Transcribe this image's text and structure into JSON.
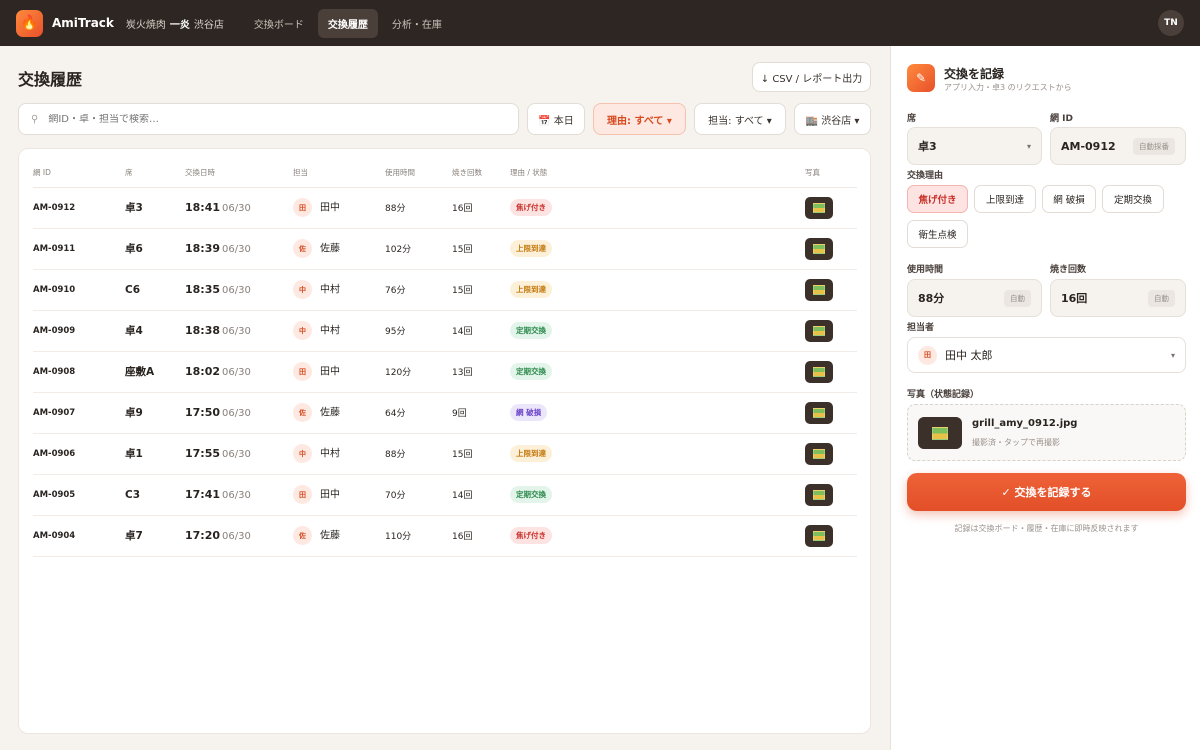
{
  "header": {
    "logo_icon": "fire-icon",
    "brand": "AmiTrack",
    "shop_prefix": "炭火焼肉",
    "shop_name": "一炎",
    "shop_branch": "渋谷店",
    "tabs": [
      "交換ボード",
      "交換履歴",
      "分析・在庫"
    ],
    "active_tab": "交換履歴",
    "user_initials": "TN"
  },
  "page": {
    "title": "交換履歴",
    "export_label": "↓ CSV / レポート出力",
    "search_placeholder": "網ID・卓・担当で検索…",
    "filters": {
      "date": "📅 本日",
      "reason": "理由: すべて ▾",
      "staff": "担当: すべて ▾",
      "store": "🏬 渋谷店 ▾"
    }
  },
  "table": {
    "headers": [
      "網 ID",
      "席",
      "交換日時",
      "担当",
      "使用時間",
      "焼き回数",
      "理由 / 状態",
      "写真"
    ],
    "rows": [
      {
        "id": "AM-0912",
        "seat": "卓3",
        "time": "18:41",
        "date": "06/30",
        "av": "田",
        "staff": "田中",
        "usage": "88分",
        "count": "16回",
        "reason": "焦げ付き",
        "tone": "red"
      },
      {
        "id": "AM-0911",
        "seat": "卓6",
        "time": "18:39",
        "date": "06/30",
        "av": "佐",
        "staff": "佐藤",
        "usage": "102分",
        "count": "15回",
        "reason": "上限到達",
        "tone": "yel"
      },
      {
        "id": "AM-0910",
        "seat": "C6",
        "time": "18:35",
        "date": "06/30",
        "av": "中",
        "staff": "中村",
        "usage": "76分",
        "count": "15回",
        "reason": "上限到達",
        "tone": "yel"
      },
      {
        "id": "AM-0909",
        "seat": "卓4",
        "time": "18:38",
        "date": "06/30",
        "av": "中",
        "staff": "中村",
        "usage": "95分",
        "count": "14回",
        "reason": "定期交換",
        "tone": "grn"
      },
      {
        "id": "AM-0908",
        "seat": "座敷A",
        "time": "18:02",
        "date": "06/30",
        "av": "田",
        "staff": "田中",
        "usage": "120分",
        "count": "13回",
        "reason": "定期交換",
        "tone": "grn"
      },
      {
        "id": "AM-0907",
        "seat": "卓9",
        "time": "17:50",
        "date": "06/30",
        "av": "佐",
        "staff": "佐藤",
        "usage": "64分",
        "count": "9回",
        "reason": "網 破損",
        "tone": "pur"
      },
      {
        "id": "AM-0906",
        "seat": "卓1",
        "time": "17:55",
        "date": "06/30",
        "av": "中",
        "staff": "中村",
        "usage": "88分",
        "count": "15回",
        "reason": "上限到達",
        "tone": "yel"
      },
      {
        "id": "AM-0905",
        "seat": "C3",
        "time": "17:41",
        "date": "06/30",
        "av": "田",
        "staff": "田中",
        "usage": "70分",
        "count": "14回",
        "reason": "定期交換",
        "tone": "grn"
      },
      {
        "id": "AM-0904",
        "seat": "卓7",
        "time": "17:20",
        "date": "06/30",
        "av": "佐",
        "staff": "佐藤",
        "usage": "110分",
        "count": "16回",
        "reason": "焦げ付き",
        "tone": "red"
      }
    ]
  },
  "form": {
    "title": "交換を記録",
    "subtitle": "アプリ入力・卓3 のリクエストから",
    "seat_label": "席",
    "seat_value": "卓3",
    "net_label": "網 ID",
    "net_value": "AM-0912",
    "net_tag": "自動採番",
    "reason_label": "交換理由",
    "reasons": [
      "焦げ付き",
      "上限到達",
      "網 破損",
      "定期交換",
      "衛生点検"
    ],
    "selected_reason": "焦げ付き",
    "usage_label": "使用時間",
    "usage_value": "88分",
    "usage_tag": "自動",
    "count_label": "焼き回数",
    "count_value": "16回",
    "count_tag": "自動",
    "staff_label": "担当者",
    "staff_avatar": "田",
    "staff_value": "田中 太郎",
    "photo_label": "写真（状態記録）",
    "photo_name": "grill_amy_0912.jpg",
    "photo_note": "撮影済・タップで再撮影",
    "submit": "✓ 交換を記録する",
    "footnote": "記録は交換ボード・履歴・在庫に即時反映されます"
  },
  "colors": {
    "accent": "#e8502a",
    "header_bg": "#2e2622"
  }
}
